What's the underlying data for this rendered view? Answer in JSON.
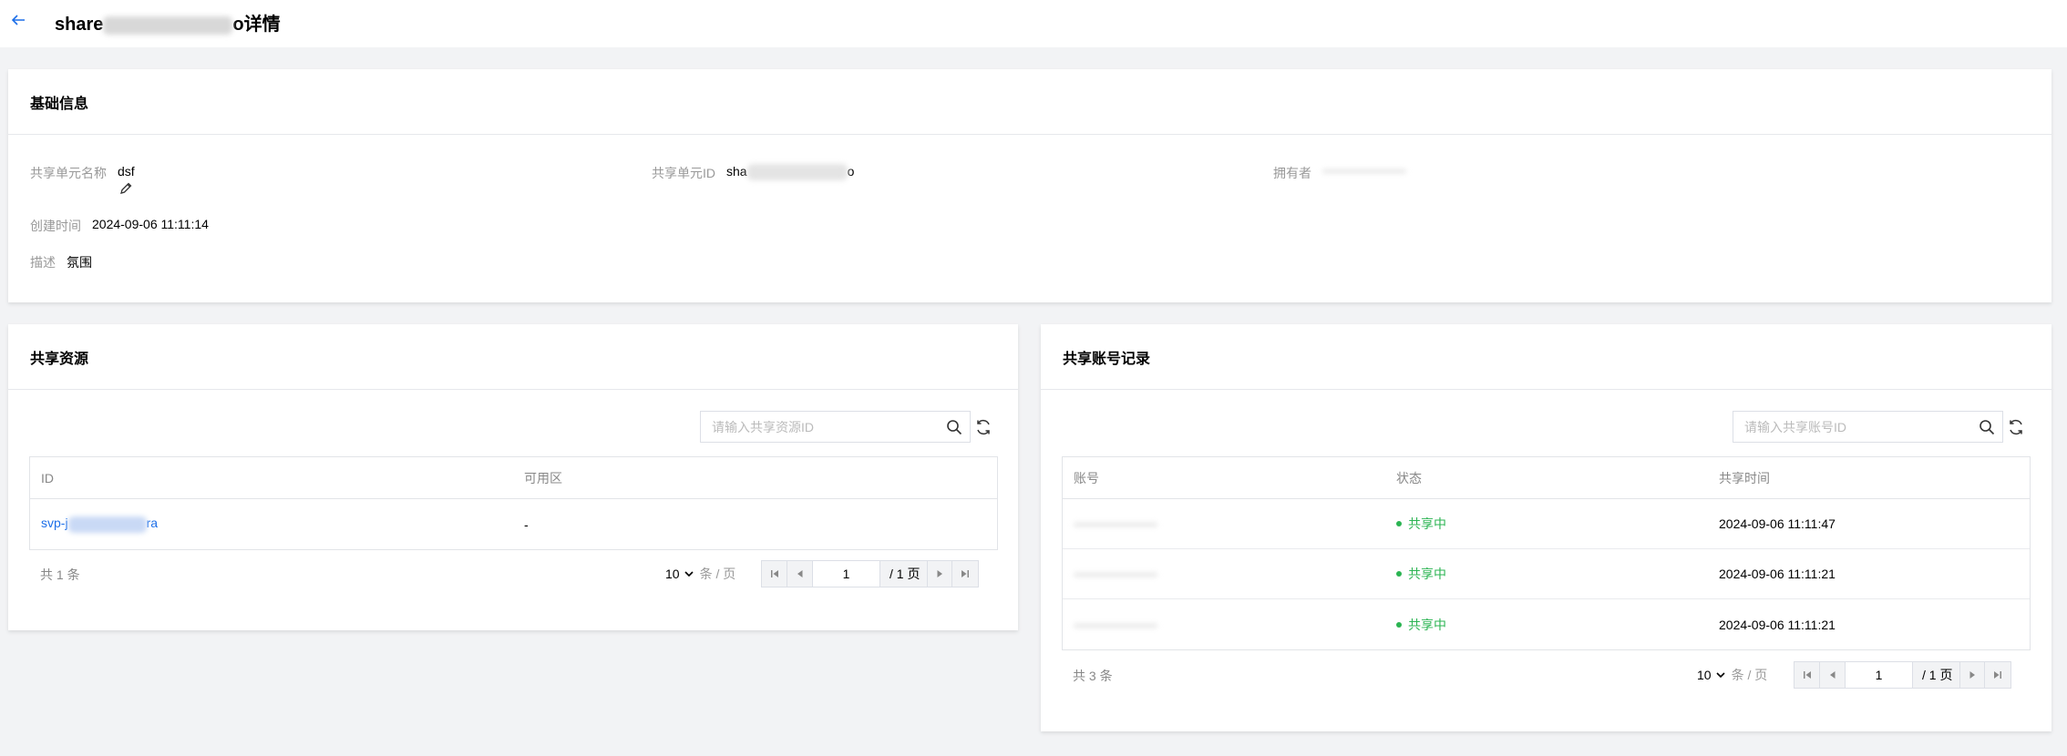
{
  "header": {
    "title_prefix": "share",
    "title_suffix": "o详情"
  },
  "basic_info": {
    "title": "基础信息",
    "name_label": "共享单元名称",
    "name_value": "dsf",
    "id_label": "共享单元ID",
    "id_prefix": "sha",
    "id_suffix": "o",
    "owner_label": "拥有者",
    "created_label": "创建时间",
    "created_value": "2024-09-06 11:11:14",
    "desc_label": "描述",
    "desc_value": "氛围"
  },
  "resources": {
    "title": "共享资源",
    "search_placeholder": "请输入共享资源ID",
    "columns": [
      "ID",
      "可用区"
    ],
    "rows": [
      {
        "id_prefix": "svp-j",
        "id_suffix": "ra",
        "zone": "-"
      }
    ],
    "total_text": "共 1 条",
    "page_size": "10",
    "page_size_unit": "条 / 页",
    "page": "1",
    "page_total": "/ 1 页"
  },
  "accounts": {
    "title": "共享账号记录",
    "search_placeholder": "请输入共享账号ID",
    "columns": [
      "账号",
      "状态",
      "共享时间"
    ],
    "rows": [
      {
        "status": "共享中",
        "time": "2024-09-06 11:11:47"
      },
      {
        "status": "共享中",
        "time": "2024-09-06 11:11:21"
      },
      {
        "status": "共享中",
        "time": "2024-09-06 11:11:21"
      }
    ],
    "total_text": "共 3 条",
    "page_size": "10",
    "page_size_unit": "条 / 页",
    "page": "1",
    "page_total": "/ 1 页"
  },
  "colors": {
    "accent": "#1d6fe8",
    "status_green": "#2bb452",
    "page_bg": "#f2f3f5"
  }
}
